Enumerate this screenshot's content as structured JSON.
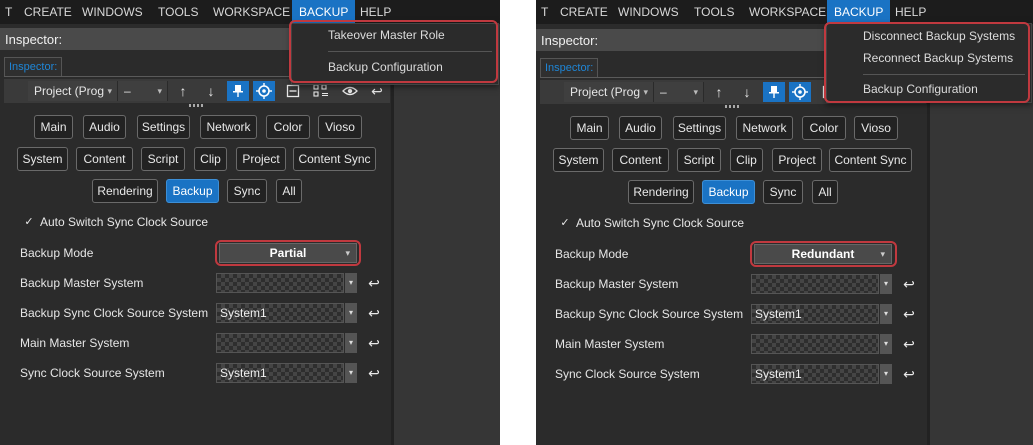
{
  "menubar": {
    "left": [
      "T",
      "CREATE",
      "WINDOWS",
      "TOOLS",
      "WORKSPACE",
      "BACKUP",
      "HELP"
    ],
    "right": [
      "T",
      "CREATE",
      "WINDOWS",
      "TOOLS",
      "WORKSPACE",
      "BACKUP",
      "HELP"
    ]
  },
  "backup_menu": {
    "left": {
      "items": [
        "Takeover Master Role",
        "Backup Configuration"
      ]
    },
    "right": {
      "items": [
        "Disconnect Backup Systems",
        "Reconnect Backup Systems",
        "Backup Configuration"
      ]
    }
  },
  "inspector": {
    "title": "Inspector:",
    "tab": "Inspector:",
    "project_dropdown": "Project (Prog",
    "second_dropdown": "–"
  },
  "filters": {
    "row1": [
      "Main",
      "Audio",
      "Settings",
      "Network",
      "Color",
      "Vioso"
    ],
    "row2": [
      "System",
      "Content",
      "Script",
      "Clip",
      "Project",
      "Content Sync"
    ],
    "row3": [
      "Rendering",
      "Backup",
      "Sync",
      "All"
    ],
    "active": "Backup"
  },
  "auto_switch": {
    "label": "Auto Switch Sync Clock Source",
    "checked": true
  },
  "properties": {
    "labels": [
      "Backup Mode",
      "Backup Master System",
      "Backup Sync Clock Source System",
      "Main Master System",
      "Sync Clock Source System"
    ],
    "left_mode": "Partial",
    "right_mode": "Redundant",
    "values": [
      "",
      "System1",
      "",
      "System1"
    ]
  },
  "icons": {
    "caret": "▾",
    "up": "↑",
    "down": "↓",
    "pin": "⌖",
    "target": "⌖",
    "reset": "↩",
    "check": "✓",
    "eye": "◉"
  },
  "colors": {
    "accent": "#1a73c4",
    "highlight": "#c0393f",
    "tab_text": "#1f86d6"
  }
}
